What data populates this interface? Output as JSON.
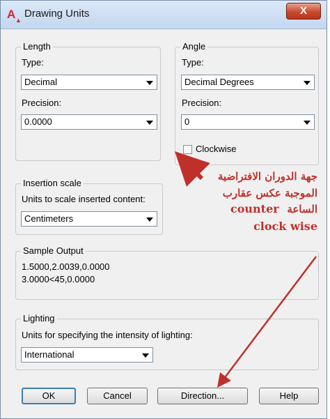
{
  "window": {
    "title": "Drawing Units",
    "close_label": "X"
  },
  "length": {
    "group_label": "Length",
    "type_label": "Type:",
    "type_value": "Decimal",
    "precision_label": "Precision:",
    "precision_value": "0.0000"
  },
  "angle": {
    "group_label": "Angle",
    "type_label": "Type:",
    "type_value": "Decimal Degrees",
    "precision_label": "Precision:",
    "precision_value": "0",
    "clockwise_label": "Clockwise",
    "clockwise_checked": false
  },
  "insertion": {
    "group_label": "Insertion scale",
    "units_label": "Units to scale inserted content:",
    "units_value": "Centimeters"
  },
  "sample": {
    "group_label": "Sample Output",
    "line1": "1.5000,2.0039,0.0000",
    "line2": "3.0000<45,0.0000"
  },
  "lighting": {
    "group_label": "Lighting",
    "units_label": "Units for specifying the intensity of lighting:",
    "units_value": "International"
  },
  "buttons": {
    "ok": "OK",
    "cancel": "Cancel",
    "direction": "Direction...",
    "help": "Help"
  },
  "annotation": {
    "line1": "جهة الدوران الافتراضية",
    "line2": "الموجبة عكس عقارب",
    "line3_arabic": "الساعة",
    "line3_latin": "counter",
    "line4": "clock wise",
    "color": "#c0302b"
  },
  "colors": {
    "accent_close": "#c74a2d",
    "default_button_border": "#3c7fb1",
    "autocad_logo": "#d8262a"
  }
}
